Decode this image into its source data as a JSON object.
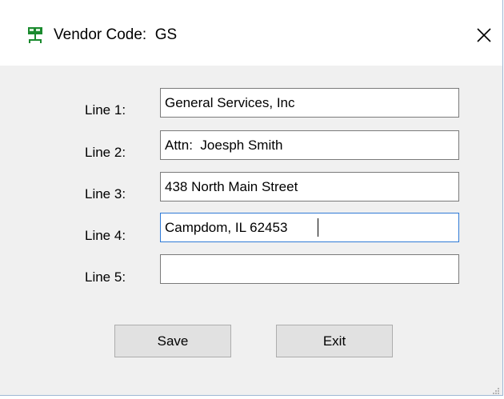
{
  "window": {
    "title": "Vendor Code:  GS",
    "icon": "network-computer-icon",
    "close_glyph": "✕"
  },
  "form": {
    "lines": [
      {
        "label": "Line 1:",
        "value": "General Services, Inc"
      },
      {
        "label": "Line 2:",
        "value": "Attn:  Joesph Smith"
      },
      {
        "label": "Line 3:",
        "value": "438 North Main Street"
      },
      {
        "label": "Line 4:",
        "value": "Campdom, IL 62453",
        "focused": true
      },
      {
        "label": "Line 5:",
        "value": ""
      }
    ]
  },
  "buttons": {
    "save_label": "Save",
    "exit_label": "Exit"
  },
  "colors": {
    "dialog_bg": "#f0f0f0",
    "titlebar_bg": "#ffffff",
    "focus_border": "#2f7ad6",
    "field_border": "#7a7a7a",
    "button_bg": "#e1e1e1",
    "icon_green": "#1a8a2e"
  }
}
